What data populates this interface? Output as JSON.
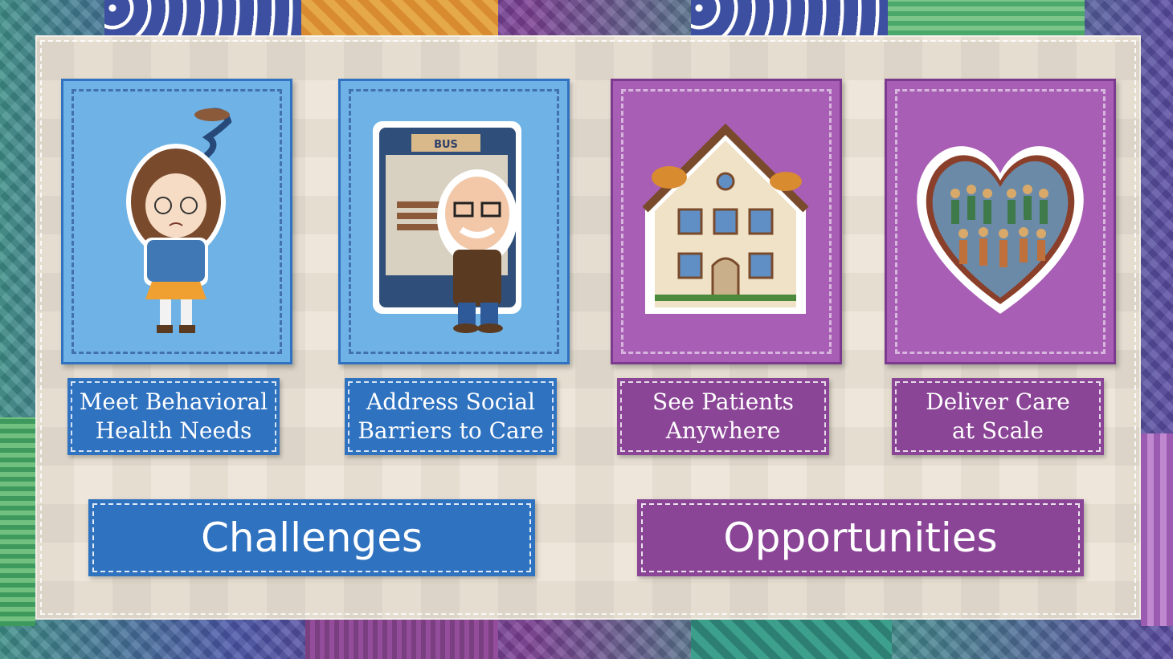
{
  "colors": {
    "challenge_blue": "#2f72c0",
    "challenge_card_blue": "#6fb3e6",
    "opportunity_purple": "#8b4596",
    "opportunity_card_purple": "#a85eb4",
    "quilt_background": "#ece4d6"
  },
  "cards": [
    {
      "icon": "girl-with-storm-cloud-icon",
      "label": "Meet Behavioral\nHealth Needs",
      "group": "challenges"
    },
    {
      "icon": "elderly-man-at-bus-stop-icon",
      "label": "Address Social\nBarriers to Care",
      "group": "challenges",
      "sign_text": "BUS"
    },
    {
      "icon": "house-icon",
      "label": "See Patients\nAnywhere",
      "group": "opportunities"
    },
    {
      "icon": "heart-with-crowd-icon",
      "label": "Deliver Care\nat Scale",
      "group": "opportunities"
    }
  ],
  "banners": {
    "challenges": "Challenges",
    "opportunities": "Opportunities"
  }
}
